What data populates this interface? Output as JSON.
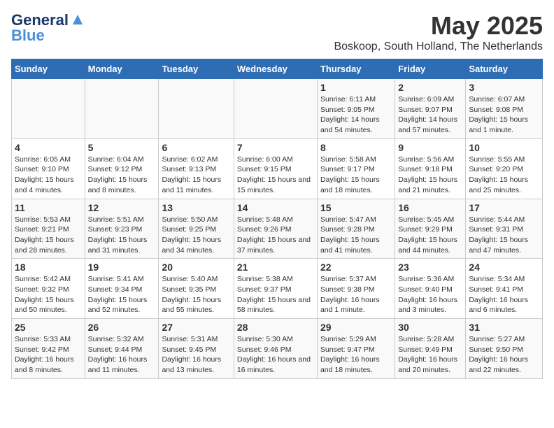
{
  "header": {
    "logo": {
      "general": "General",
      "blue": "Blue",
      "triangle": "▲"
    },
    "month": "May 2025",
    "location": "Boskoop, South Holland, The Netherlands"
  },
  "days_of_week": [
    "Sunday",
    "Monday",
    "Tuesday",
    "Wednesday",
    "Thursday",
    "Friday",
    "Saturday"
  ],
  "weeks": [
    [
      {
        "day": "",
        "info": ""
      },
      {
        "day": "",
        "info": ""
      },
      {
        "day": "",
        "info": ""
      },
      {
        "day": "",
        "info": ""
      },
      {
        "day": "1",
        "sunrise": "Sunrise: 6:11 AM",
        "sunset": "Sunset: 9:05 PM",
        "daylight": "Daylight: 14 hours and 54 minutes."
      },
      {
        "day": "2",
        "sunrise": "Sunrise: 6:09 AM",
        "sunset": "Sunset: 9:07 PM",
        "daylight": "Daylight: 14 hours and 57 minutes."
      },
      {
        "day": "3",
        "sunrise": "Sunrise: 6:07 AM",
        "sunset": "Sunset: 9:08 PM",
        "daylight": "Daylight: 15 hours and 1 minute."
      }
    ],
    [
      {
        "day": "4",
        "sunrise": "Sunrise: 6:05 AM",
        "sunset": "Sunset: 9:10 PM",
        "daylight": "Daylight: 15 hours and 4 minutes."
      },
      {
        "day": "5",
        "sunrise": "Sunrise: 6:04 AM",
        "sunset": "Sunset: 9:12 PM",
        "daylight": "Daylight: 15 hours and 8 minutes."
      },
      {
        "day": "6",
        "sunrise": "Sunrise: 6:02 AM",
        "sunset": "Sunset: 9:13 PM",
        "daylight": "Daylight: 15 hours and 11 minutes."
      },
      {
        "day": "7",
        "sunrise": "Sunrise: 6:00 AM",
        "sunset": "Sunset: 9:15 PM",
        "daylight": "Daylight: 15 hours and 15 minutes."
      },
      {
        "day": "8",
        "sunrise": "Sunrise: 5:58 AM",
        "sunset": "Sunset: 9:17 PM",
        "daylight": "Daylight: 15 hours and 18 minutes."
      },
      {
        "day": "9",
        "sunrise": "Sunrise: 5:56 AM",
        "sunset": "Sunset: 9:18 PM",
        "daylight": "Daylight: 15 hours and 21 minutes."
      },
      {
        "day": "10",
        "sunrise": "Sunrise: 5:55 AM",
        "sunset": "Sunset: 9:20 PM",
        "daylight": "Daylight: 15 hours and 25 minutes."
      }
    ],
    [
      {
        "day": "11",
        "sunrise": "Sunrise: 5:53 AM",
        "sunset": "Sunset: 9:21 PM",
        "daylight": "Daylight: 15 hours and 28 minutes."
      },
      {
        "day": "12",
        "sunrise": "Sunrise: 5:51 AM",
        "sunset": "Sunset: 9:23 PM",
        "daylight": "Daylight: 15 hours and 31 minutes."
      },
      {
        "day": "13",
        "sunrise": "Sunrise: 5:50 AM",
        "sunset": "Sunset: 9:25 PM",
        "daylight": "Daylight: 15 hours and 34 minutes."
      },
      {
        "day": "14",
        "sunrise": "Sunrise: 5:48 AM",
        "sunset": "Sunset: 9:26 PM",
        "daylight": "Daylight: 15 hours and 37 minutes."
      },
      {
        "day": "15",
        "sunrise": "Sunrise: 5:47 AM",
        "sunset": "Sunset: 9:28 PM",
        "daylight": "Daylight: 15 hours and 41 minutes."
      },
      {
        "day": "16",
        "sunrise": "Sunrise: 5:45 AM",
        "sunset": "Sunset: 9:29 PM",
        "daylight": "Daylight: 15 hours and 44 minutes."
      },
      {
        "day": "17",
        "sunrise": "Sunrise: 5:44 AM",
        "sunset": "Sunset: 9:31 PM",
        "daylight": "Daylight: 15 hours and 47 minutes."
      }
    ],
    [
      {
        "day": "18",
        "sunrise": "Sunrise: 5:42 AM",
        "sunset": "Sunset: 9:32 PM",
        "daylight": "Daylight: 15 hours and 50 minutes."
      },
      {
        "day": "19",
        "sunrise": "Sunrise: 5:41 AM",
        "sunset": "Sunset: 9:34 PM",
        "daylight": "Daylight: 15 hours and 52 minutes."
      },
      {
        "day": "20",
        "sunrise": "Sunrise: 5:40 AM",
        "sunset": "Sunset: 9:35 PM",
        "daylight": "Daylight: 15 hours and 55 minutes."
      },
      {
        "day": "21",
        "sunrise": "Sunrise: 5:38 AM",
        "sunset": "Sunset: 9:37 PM",
        "daylight": "Daylight: 15 hours and 58 minutes."
      },
      {
        "day": "22",
        "sunrise": "Sunrise: 5:37 AM",
        "sunset": "Sunset: 9:38 PM",
        "daylight": "Daylight: 16 hours and 1 minute."
      },
      {
        "day": "23",
        "sunrise": "Sunrise: 5:36 AM",
        "sunset": "Sunset: 9:40 PM",
        "daylight": "Daylight: 16 hours and 3 minutes."
      },
      {
        "day": "24",
        "sunrise": "Sunrise: 5:34 AM",
        "sunset": "Sunset: 9:41 PM",
        "daylight": "Daylight: 16 hours and 6 minutes."
      }
    ],
    [
      {
        "day": "25",
        "sunrise": "Sunrise: 5:33 AM",
        "sunset": "Sunset: 9:42 PM",
        "daylight": "Daylight: 16 hours and 8 minutes."
      },
      {
        "day": "26",
        "sunrise": "Sunrise: 5:32 AM",
        "sunset": "Sunset: 9:44 PM",
        "daylight": "Daylight: 16 hours and 11 minutes."
      },
      {
        "day": "27",
        "sunrise": "Sunrise: 5:31 AM",
        "sunset": "Sunset: 9:45 PM",
        "daylight": "Daylight: 16 hours and 13 minutes."
      },
      {
        "day": "28",
        "sunrise": "Sunrise: 5:30 AM",
        "sunset": "Sunset: 9:46 PM",
        "daylight": "Daylight: 16 hours and 16 minutes."
      },
      {
        "day": "29",
        "sunrise": "Sunrise: 5:29 AM",
        "sunset": "Sunset: 9:47 PM",
        "daylight": "Daylight: 16 hours and 18 minutes."
      },
      {
        "day": "30",
        "sunrise": "Sunrise: 5:28 AM",
        "sunset": "Sunset: 9:49 PM",
        "daylight": "Daylight: 16 hours and 20 minutes."
      },
      {
        "day": "31",
        "sunrise": "Sunrise: 5:27 AM",
        "sunset": "Sunset: 9:50 PM",
        "daylight": "Daylight: 16 hours and 22 minutes."
      }
    ]
  ]
}
